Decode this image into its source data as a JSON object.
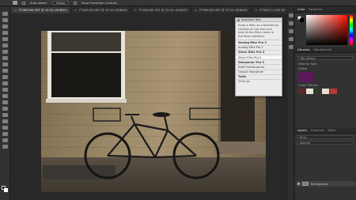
{
  "options_bar": {
    "auto_select_label": "Auto-Select:",
    "auto_select_value": "Group",
    "show_transform_label": "Show Transform Controls"
  },
  "tabs": [
    {
      "label": "P7060184.ORF @ 33.3% (RGB/8*)",
      "active": true
    },
    {
      "label": "P7060183.ORF @ 33.3% (RGB/8*)",
      "active": false
    },
    {
      "label": "P7060182.ORF @ 33.3% (RGB/8*)",
      "active": false
    },
    {
      "label": "P7060185.ORF @ 33.3% (RGB/8*)",
      "active": false
    },
    {
      "label": "P7060171.ORF @ 33.3% (RGB/8*)",
      "active": false
    },
    {
      "label": "P7060172.ORF @ 33.3% (RGB/8*)",
      "active": false
    }
  ],
  "filter_menu": {
    "header": "Selective Tool",
    "description": "mark a filter as a favorite by clicking on the star icon next to the filter name in the filter interface.",
    "items": [
      {
        "label": "Analog Efex Pro 2",
        "bold": true
      },
      {
        "label": "Analog Efex Pro 2",
        "bold": false
      },
      {
        "label": "Silver Efex Pro 2",
        "bold": true
      },
      {
        "label": "Silver Efex Pro 2",
        "bold": false
      },
      {
        "label": "Sharpener Pro 3",
        "bold": true
      },
      {
        "label": "RAW Presharpener",
        "bold": false
      },
      {
        "label": "Output Sharpener",
        "bold": false
      },
      {
        "label": "Tools",
        "bold": true
      }
    ],
    "footer": "Settings"
  },
  "right_panel": {
    "color_tab": "Color",
    "swatches_tab": "Swatches",
    "libraries_tab": "Libraries",
    "adjustments_tab": "Adjustments",
    "library_select": "My Library",
    "view_by": "View by Type",
    "colors_label": "Colors",
    "theme_label": "Color Themes",
    "theme_colors": [
      "#5a2a24",
      "#e6e2d8",
      "#2e3a2e",
      "#e7ddd0",
      "#b23a3a"
    ],
    "layers_tab": "Layers",
    "channels_tab": "Channels",
    "paths_tab": "Paths",
    "kind_filter": "Kind",
    "blend_mode": "Normal",
    "layer_name": "Background"
  },
  "colors": {
    "library_swatch": "#5a1a5a",
    "fg": "#000000",
    "bg": "#ffffff"
  }
}
